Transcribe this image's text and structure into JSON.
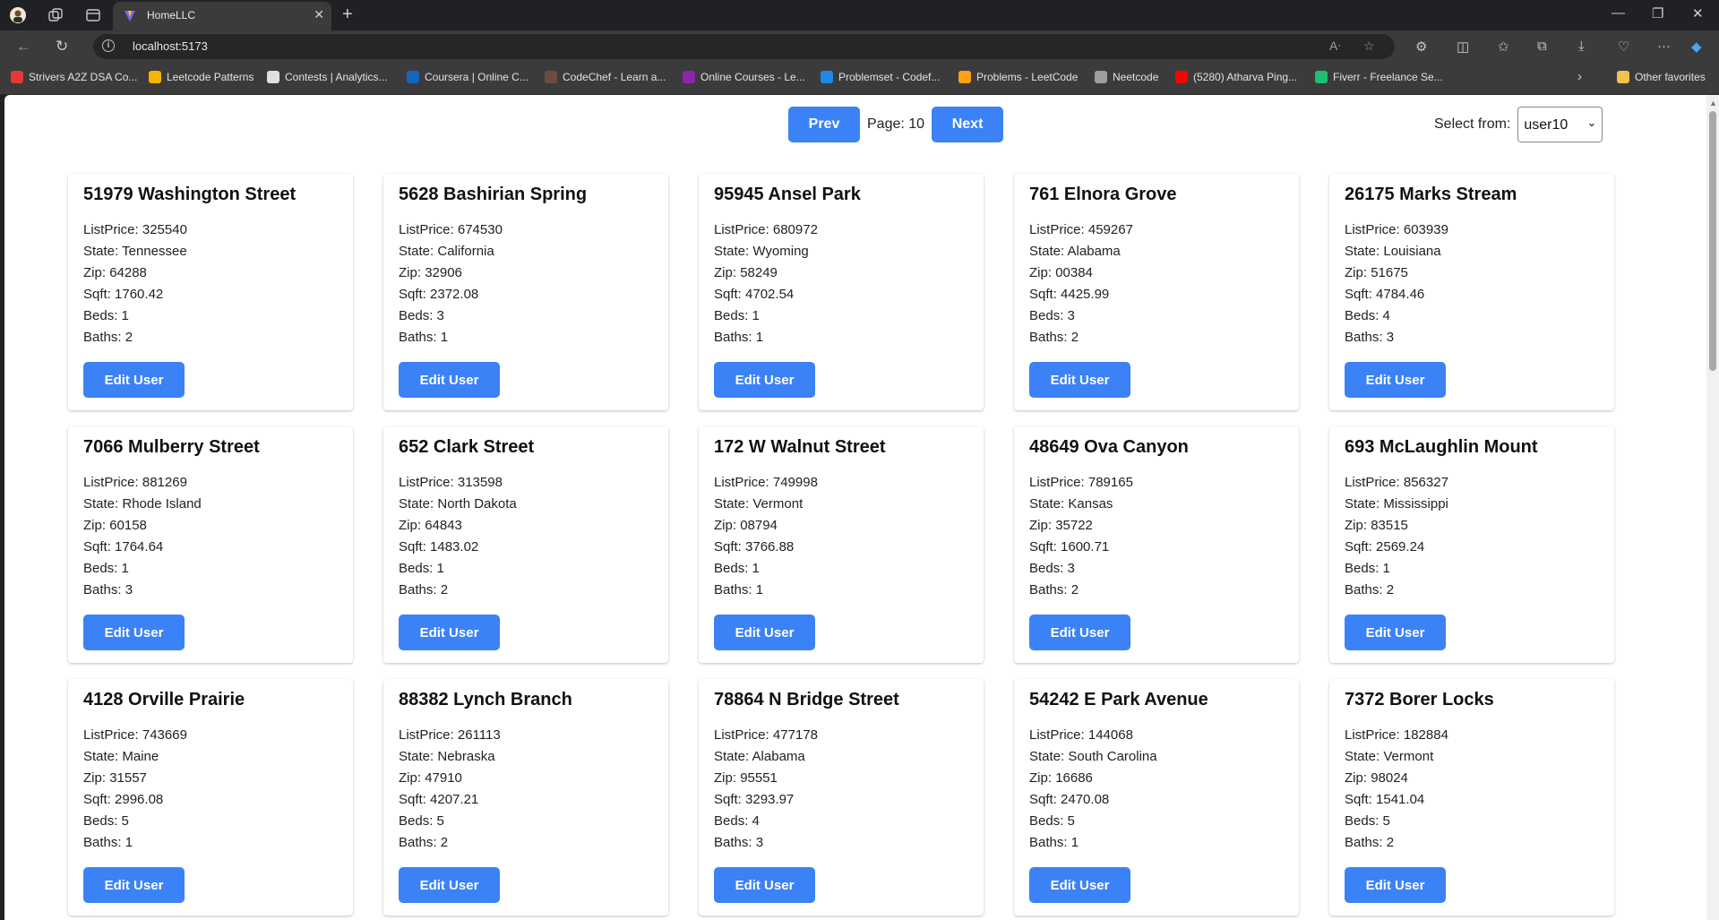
{
  "browser": {
    "tab_title": "HomeLLC",
    "url": "localhost:5173",
    "bookmarks": [
      {
        "label": "Strivers A2Z DSA Co...",
        "color": "#e53935"
      },
      {
        "label": "Leetcode Patterns",
        "color": "#f5b400"
      },
      {
        "label": "Contests | Analytics...",
        "color": "#e0e0e0"
      },
      {
        "label": "Coursera | Online C...",
        "color": "#1565c0"
      },
      {
        "label": "CodeChef - Learn a...",
        "color": "#6d4c41"
      },
      {
        "label": "Online Courses - Le...",
        "color": "#8e24aa"
      },
      {
        "label": "Problemset - Codef...",
        "color": "#1e88e5"
      },
      {
        "label": "Problems - LeetCode",
        "color": "#ffa116"
      },
      {
        "label": "Neetcode",
        "color": "#9e9e9e"
      },
      {
        "label": "(5280) Atharva Ping...",
        "color": "#ff0000"
      },
      {
        "label": "Fiverr - Freelance Se...",
        "color": "#1dbf73"
      }
    ],
    "other_favorites": "Other favorites"
  },
  "pager": {
    "prev_label": "Prev",
    "page_label": "Page: 10",
    "next_label": "Next"
  },
  "user_select": {
    "label": "Select from:",
    "value": "user10"
  },
  "card_fields": {
    "list_price": "ListPrice:",
    "state": "State:",
    "zip": "Zip:",
    "sqft": "Sqft:",
    "beds": "Beds:",
    "baths": "Baths:"
  },
  "edit_button_label": "Edit User",
  "listings": [
    {
      "title": "51979 Washington Street",
      "list_price": "325540",
      "state": "Tennessee",
      "zip": "64288",
      "sqft": "1760.42",
      "beds": "1",
      "baths": "2"
    },
    {
      "title": "5628 Bashirian Spring",
      "list_price": "674530",
      "state": "California",
      "zip": "32906",
      "sqft": "2372.08",
      "beds": "3",
      "baths": "1"
    },
    {
      "title": "95945 Ansel Park",
      "list_price": "680972",
      "state": "Wyoming",
      "zip": "58249",
      "sqft": "4702.54",
      "beds": "1",
      "baths": "1"
    },
    {
      "title": "761 Elnora Grove",
      "list_price": "459267",
      "state": "Alabama",
      "zip": "00384",
      "sqft": "4425.99",
      "beds": "3",
      "baths": "2"
    },
    {
      "title": "26175 Marks Stream",
      "list_price": "603939",
      "state": "Louisiana",
      "zip": "51675",
      "sqft": "4784.46",
      "beds": "4",
      "baths": "3"
    },
    {
      "title": "7066 Mulberry Street",
      "list_price": "881269",
      "state": "Rhode Island",
      "zip": "60158",
      "sqft": "1764.64",
      "beds": "1",
      "baths": "3"
    },
    {
      "title": "652 Clark Street",
      "list_price": "313598",
      "state": "North Dakota",
      "zip": "64843",
      "sqft": "1483.02",
      "beds": "1",
      "baths": "2"
    },
    {
      "title": "172 W Walnut Street",
      "list_price": "749998",
      "state": "Vermont",
      "zip": "08794",
      "sqft": "3766.88",
      "beds": "1",
      "baths": "1"
    },
    {
      "title": "48649 Ova Canyon",
      "list_price": "789165",
      "state": "Kansas",
      "zip": "35722",
      "sqft": "1600.71",
      "beds": "3",
      "baths": "2"
    },
    {
      "title": "693 McLaughlin Mount",
      "list_price": "856327",
      "state": "Mississippi",
      "zip": "83515",
      "sqft": "2569.24",
      "beds": "1",
      "baths": "2"
    },
    {
      "title": "4128 Orville Prairie",
      "list_price": "743669",
      "state": "Maine",
      "zip": "31557",
      "sqft": "2996.08",
      "beds": "5",
      "baths": "1"
    },
    {
      "title": "88382 Lynch Branch",
      "list_price": "261113",
      "state": "Nebraska",
      "zip": "47910",
      "sqft": "4207.21",
      "beds": "5",
      "baths": "2"
    },
    {
      "title": "78864 N Bridge Street",
      "list_price": "477178",
      "state": "Alabama",
      "zip": "95551",
      "sqft": "3293.97",
      "beds": "4",
      "baths": "3"
    },
    {
      "title": "54242 E Park Avenue",
      "list_price": "144068",
      "state": "South Carolina",
      "zip": "16686",
      "sqft": "2470.08",
      "beds": "5",
      "baths": "1"
    },
    {
      "title": "7372 Borer Locks",
      "list_price": "182884",
      "state": "Vermont",
      "zip": "98024",
      "sqft": "1541.04",
      "beds": "5",
      "baths": "2"
    }
  ]
}
